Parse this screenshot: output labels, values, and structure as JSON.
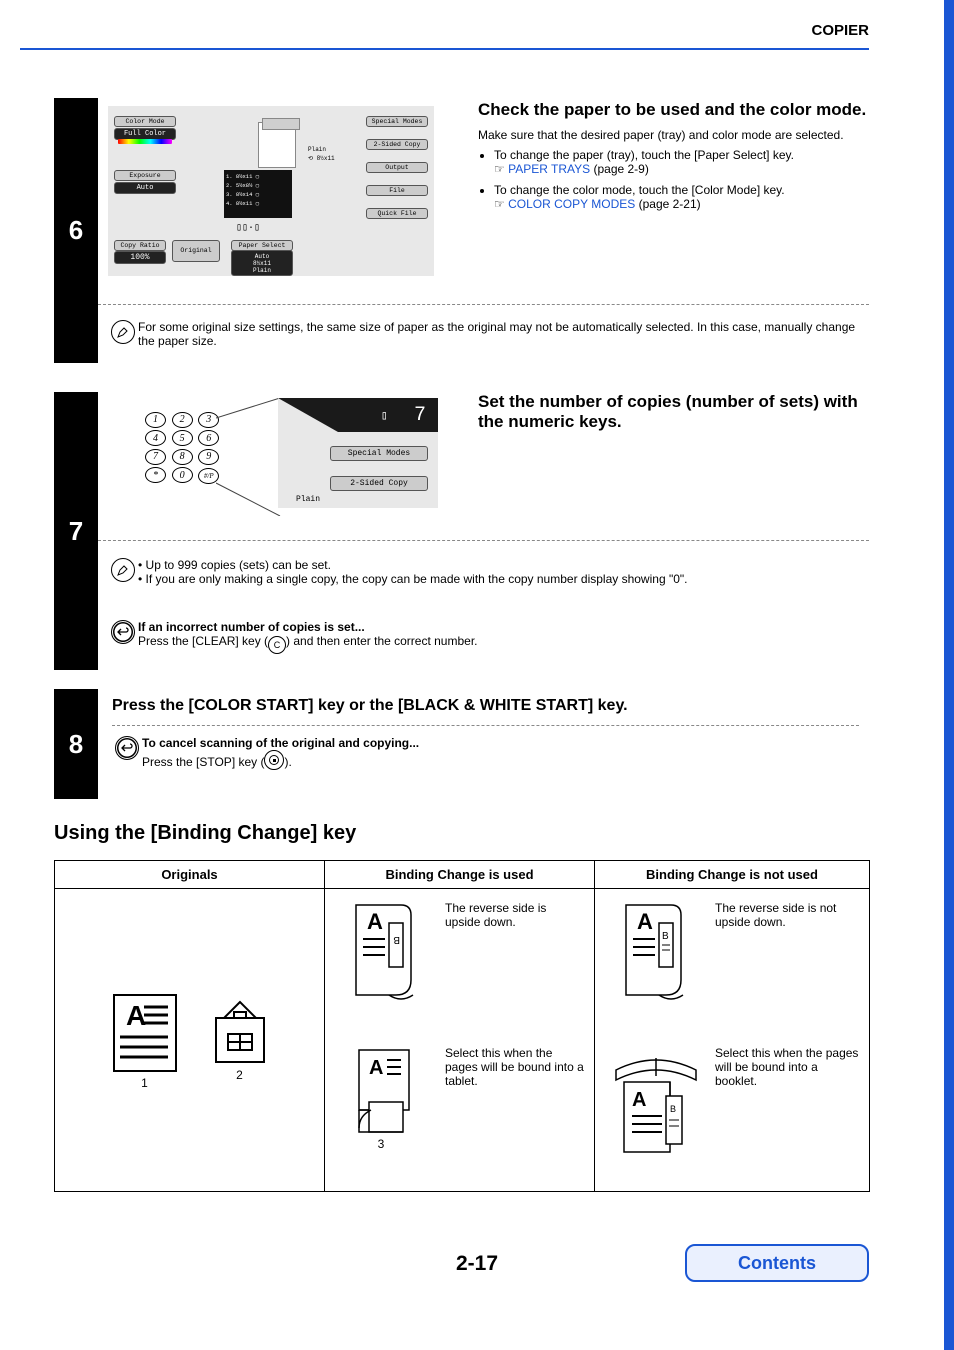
{
  "header": {
    "section": "COPIER"
  },
  "step6": {
    "number": "6",
    "title": "Check the paper to be used and the color mode.",
    "subtitle": "Make sure that the desired paper (tray) and color mode are selected.",
    "bullets": [
      {
        "text": "To change the paper (tray), touch the [Paper Select] key.",
        "link": "PAPER TRAYS",
        "page": "(page 2-9)"
      },
      {
        "text": "To change the color mode, touch the [Color Mode] key.",
        "link": "COLOR COPY MODES",
        "page": "(page 2-21)"
      }
    ],
    "note": "For some original size settings, the same size of paper as the original may not be automatically selected. In this case, manually change the paper size.",
    "lcd": {
      "color_mode_label": "Color Mode",
      "full_color": "Full Color",
      "exposure_label": "Exposure",
      "auto": "Auto",
      "copy_ratio_label": "Copy Ratio",
      "ratio": "100%",
      "original": "Original",
      "original_size": "8½x11",
      "paper_select": "Paper Select",
      "ps_auto": "Auto",
      "ps_size": "8½x11",
      "ps_plain": "Plain",
      "plain": "Plain",
      "preview_size": "8½x11",
      "tray1": "1.  8½x11",
      "tray2": "2.  5½x8½",
      "tray3": "3.  8½x14",
      "tray4": "4.  8½x11",
      "special_modes": "Special Modes",
      "two_sided": "2-Sided Copy",
      "output": "Output",
      "file": "File",
      "quick_file": "Quick File"
    }
  },
  "step7": {
    "number": "7",
    "title": "Set the number of copies (number of sets) with the numeric keys.",
    "copies_display": "7",
    "lcd_special": "Special Modes",
    "lcd_2sided": "2-Sided Copy",
    "lcd_plain": "Plain",
    "keys": [
      "1",
      "2",
      "3",
      "4",
      "5",
      "6",
      "7",
      "8",
      "9",
      "*",
      "0",
      "#/P"
    ],
    "note1_a": "Up to 999 copies (sets) can be set.",
    "note1_b": "If you are only making a single copy, the copy can be made with the copy number display showing \"0\".",
    "note2_title": "If an incorrect number of copies is set...",
    "note2_body_a": "Press the [CLEAR] key (",
    "note2_body_b": ") and then enter the correct number.",
    "clear_key": "C"
  },
  "step8": {
    "number": "8",
    "title": "Press the [COLOR START] key or the [BLACK & WHITE START] key.",
    "note_title": "To cancel scanning of the original and copying...",
    "note_body_a": "Press the [STOP] key (",
    "note_body_b": ")."
  },
  "binding": {
    "heading": "Using the [Binding Change] key",
    "cols": {
      "orig": "Originals",
      "used": "Binding Change is used",
      "not": "Binding Change is not used"
    },
    "orig_labels": {
      "one": "1",
      "two": "2"
    },
    "used": {
      "row1": "The reverse side is upside down.",
      "row2": "Select this when the pages will be bound into a tablet.",
      "row2_num": "3"
    },
    "not": {
      "row1": "The reverse side is not upside down.",
      "row2": "Select this when the pages will be bound into a booklet."
    }
  },
  "footer": {
    "page": "2-17",
    "contents": "Contents"
  }
}
